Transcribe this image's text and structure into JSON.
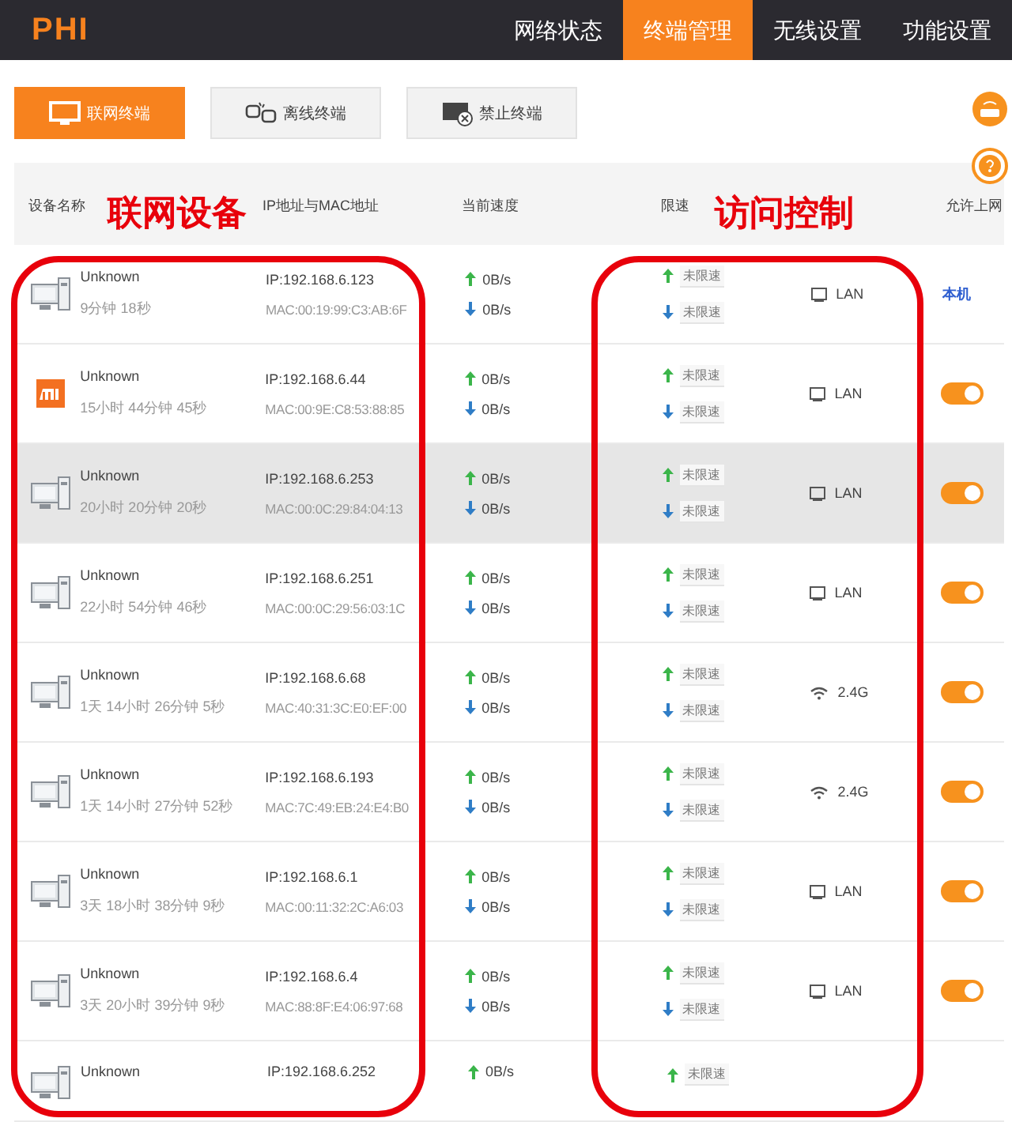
{
  "logo": "PHI",
  "nav": [
    {
      "label": "网络状态",
      "selected": false
    },
    {
      "label": "终端管理",
      "selected": true
    },
    {
      "label": "无线设置",
      "selected": false
    },
    {
      "label": "功能设置",
      "selected": false
    }
  ],
  "subtabs": [
    {
      "label": "联网终端",
      "kind": "online",
      "selected": true
    },
    {
      "label": "离线终端",
      "kind": "offline",
      "selected": false
    },
    {
      "label": "禁止终端",
      "kind": "blocked",
      "selected": false
    }
  ],
  "table": {
    "columns": [
      "设备名称",
      "IP地址与MAC地址",
      "当前速度",
      "限速",
      "允许上网"
    ],
    "rows": [
      {
        "kind": "computer",
        "name": "Unknown",
        "uptime": "9分钟 18秒",
        "ip": "IP:192.168.6.123",
        "mac": "MAC:00:19:99:C3:AB:6F",
        "up": "0B/s",
        "down": "0B/s",
        "limit_up": "未限速",
        "limit_down": "未限速",
        "access": {
          "kind": "lan",
          "label": "LAN"
        },
        "allow": {
          "kind": "label",
          "text": "本机"
        },
        "highlighted": false
      },
      {
        "kind": "mi",
        "name": "Unknown",
        "uptime": "15小时 44分钟 45秒",
        "ip": "IP:192.168.6.44",
        "mac": "MAC:00:9E:C8:53:88:85",
        "up": "0B/s",
        "down": "0B/s",
        "limit_up": "未限速",
        "limit_down": "未限速",
        "access": {
          "kind": "lan",
          "label": "LAN"
        },
        "allow": {
          "kind": "toggle",
          "on": true
        },
        "highlighted": false
      },
      {
        "kind": "computer",
        "name": "Unknown",
        "uptime": "20小时 20分钟 20秒",
        "ip": "IP:192.168.6.253",
        "mac": "MAC:00:0C:29:84:04:13",
        "up": "0B/s",
        "down": "0B/s",
        "limit_up": "未限速",
        "limit_down": "未限速",
        "access": {
          "kind": "lan",
          "label": "LAN"
        },
        "allow": {
          "kind": "toggle",
          "on": true
        },
        "highlighted": true
      },
      {
        "kind": "computer",
        "name": "Unknown",
        "uptime": "22小时 54分钟 46秒",
        "ip": "IP:192.168.6.251",
        "mac": "MAC:00:0C:29:56:03:1C",
        "up": "0B/s",
        "down": "0B/s",
        "limit_up": "未限速",
        "limit_down": "未限速",
        "access": {
          "kind": "lan",
          "label": "LAN"
        },
        "allow": {
          "kind": "toggle",
          "on": true
        },
        "highlighted": false
      },
      {
        "kind": "computer",
        "name": "Unknown",
        "uptime": "1天 14小时 26分钟 5秒",
        "ip": "IP:192.168.6.68",
        "mac": "MAC:40:31:3C:E0:EF:00",
        "up": "0B/s",
        "down": "0B/s",
        "limit_up": "未限速",
        "limit_down": "未限速",
        "access": {
          "kind": "wifi",
          "label": "2.4G"
        },
        "allow": {
          "kind": "toggle",
          "on": true
        },
        "highlighted": false
      },
      {
        "kind": "computer",
        "name": "Unknown",
        "uptime": "1天 14小时 27分钟 52秒",
        "ip": "IP:192.168.6.193",
        "mac": "MAC:7C:49:EB:24:E4:B0",
        "up": "0B/s",
        "down": "0B/s",
        "limit_up": "未限速",
        "limit_down": "未限速",
        "access": {
          "kind": "wifi",
          "label": "2.4G"
        },
        "allow": {
          "kind": "toggle",
          "on": true
        },
        "highlighted": false
      },
      {
        "kind": "computer",
        "name": "Unknown",
        "uptime": "3天 18小时 38分钟 9秒",
        "ip": "IP:192.168.6.1",
        "mac": "MAC:00:11:32:2C:A6:03",
        "up": "0B/s",
        "down": "0B/s",
        "limit_up": "未限速",
        "limit_down": "未限速",
        "access": {
          "kind": "lan",
          "label": "LAN"
        },
        "allow": {
          "kind": "toggle",
          "on": true
        },
        "highlighted": false
      },
      {
        "kind": "computer",
        "name": "Unknown",
        "uptime": "3天 20小时 39分钟 9秒",
        "ip": "IP:192.168.6.4",
        "mac": "MAC:88:8F:E4:06:97:68",
        "up": "0B/s",
        "down": "0B/s",
        "limit_up": "未限速",
        "limit_down": "未限速",
        "access": {
          "kind": "lan",
          "label": "LAN"
        },
        "allow": {
          "kind": "toggle",
          "on": true
        },
        "highlighted": false
      },
      {
        "kind": "computer",
        "name": "Unknown",
        "ip": "IP:192.168.6.252",
        "up": "0B/s",
        "limit_up": "未限速",
        "highlighted": false
      }
    ]
  },
  "annotations": [
    {
      "text": "联网设备"
    },
    {
      "text": "访问控制"
    }
  ]
}
